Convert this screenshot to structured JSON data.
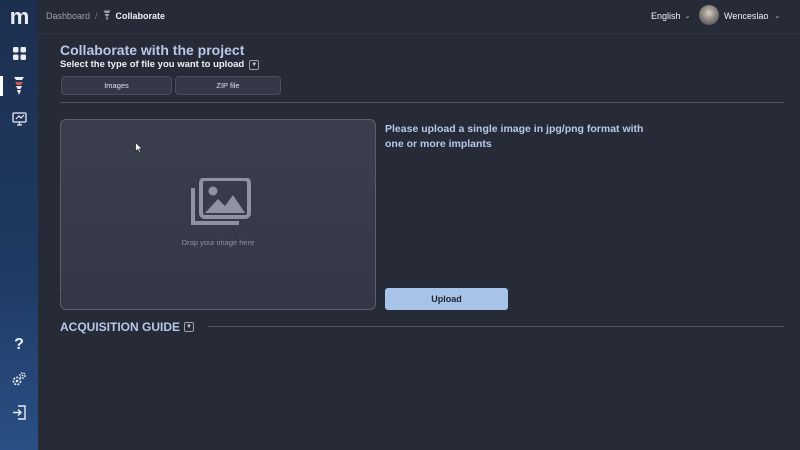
{
  "sidebar": {
    "logo": "m",
    "items": [
      {
        "name": "dashboard",
        "icon": "grid-icon"
      },
      {
        "name": "collaborate",
        "icon": "implant-icon",
        "active": true
      },
      {
        "name": "presentation",
        "icon": "board-icon"
      }
    ],
    "bottom_items": [
      {
        "name": "help",
        "icon": "question-icon",
        "label": "?"
      },
      {
        "name": "settings",
        "icon": "gears-icon"
      },
      {
        "name": "logout",
        "icon": "logout-icon"
      }
    ]
  },
  "header": {
    "breadcrumb": {
      "root": "Dashboard",
      "separator": "/",
      "current": "Collaborate"
    },
    "language": "English",
    "username": "Wenceslao"
  },
  "page": {
    "title": "Collaborate with the project",
    "subtitle": "Select the type of file you want to upload",
    "tabs": [
      {
        "label": "Images"
      },
      {
        "label": "ZIP file"
      }
    ],
    "dropzone_text": "Drop your image here",
    "instructions": "Please upload a single image in jpg/png format with one or more implants",
    "upload_label": "Upload",
    "guide_title": "ACQUISITION GUIDE"
  },
  "colors": {
    "background": "#272b38",
    "sidebar": "#1f3a63",
    "accent": "#b5c9e8",
    "button": "#a8c3e8"
  }
}
